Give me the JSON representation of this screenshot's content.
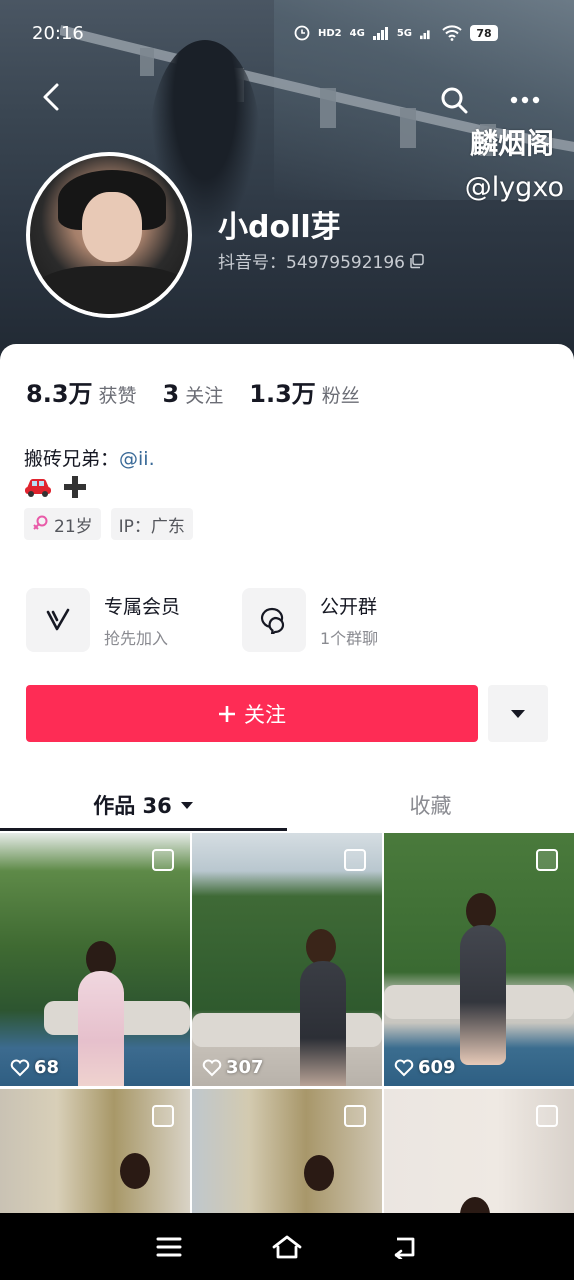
{
  "status_bar": {
    "time": "20:16",
    "indicators": [
      "HD2",
      "4G",
      "5G"
    ],
    "battery": "78"
  },
  "watermark": {
    "line1": "麟烟阁",
    "line2": "@lygxo"
  },
  "profile": {
    "nickname": "小doll芽",
    "douyin_id": "抖音号：54979592196"
  },
  "stats": [
    {
      "num": "8.3万",
      "label": "获赞"
    },
    {
      "num": "3",
      "label": "关注"
    },
    {
      "num": "1.3万",
      "label": "粉丝"
    }
  ],
  "bio": {
    "prefix": "搬砖兄弟：",
    "mention": "@ii."
  },
  "tags": {
    "age": "21岁",
    "ip": "IP：广东"
  },
  "features": {
    "member_title": "专属会员",
    "member_sub": "抢先加入",
    "group_title": "公开群",
    "group_sub": "1个群聊"
  },
  "follow_label": "关注",
  "tabs": {
    "works": "作品 36",
    "favorites": "收藏"
  },
  "videos": [
    {
      "likes": "68"
    },
    {
      "likes": "307"
    },
    {
      "likes": "609"
    },
    {
      "likes": ""
    },
    {
      "likes": ""
    },
    {
      "likes": ""
    }
  ],
  "colors": {
    "follow_button": "#fe2c55",
    "mention": "#3a6a98",
    "gender_female": "#e85aa8"
  }
}
